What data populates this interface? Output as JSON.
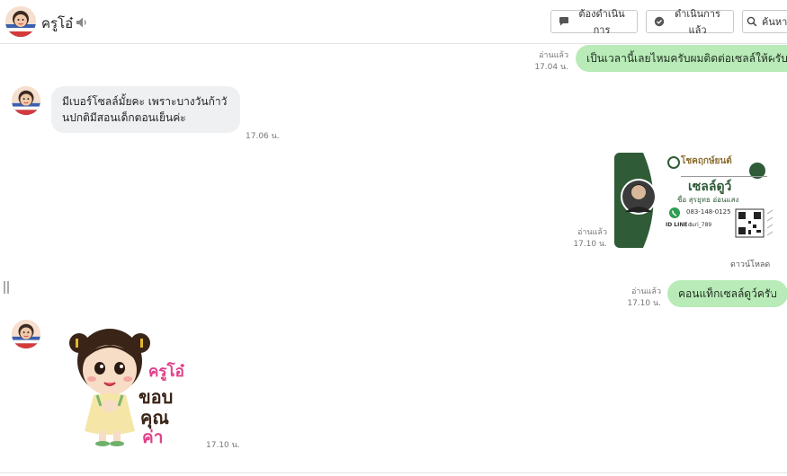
{
  "header": {
    "contact_name": "ครูโอ๋",
    "buttons": {
      "todo": "ต้องดำเนินการ",
      "done": "ดำเนินการแล้ว",
      "search": "ค้นหา"
    }
  },
  "messages": [
    {
      "id": "m1",
      "from": "me",
      "text": "เป็นเวลานี้เลยไหมครับผมติดต่อเซลล์ให้ครับ",
      "read": "อ่านแล้ว",
      "time": "17.04 น."
    },
    {
      "id": "m2",
      "from": "them",
      "text": "มีเบอร์โซลล์มั้ยคะ เพราะบางวันก้าวันปกติมีสอนเด็กตอนเย็นค่ะ",
      "time": "17.06 น."
    },
    {
      "id": "m3",
      "from": "me",
      "type": "image",
      "read": "อ่านแล้ว",
      "time": "17.10 น.",
      "download": "ดาวน์โหลด",
      "card": {
        "brand": "โชคฤกษ์ยนต์",
        "title": "เซลล์ดูว์",
        "name": "ชื่อ สุรยุทธ อ่อนแสง",
        "phone": "083-148-0125",
        "line_label": "ID LINE :",
        "line_id": "duri_789"
      }
    },
    {
      "id": "m4",
      "from": "me",
      "text": "คอนแท็กเซลล์ดูว์ครับ",
      "read": "อ่านแล้ว",
      "time": "17.10 น."
    },
    {
      "id": "m5",
      "from": "them",
      "type": "sticker",
      "time": "17.10 น.",
      "sticker_text": [
        "ครูโอ๋",
        "ขอบ",
        "คุณ",
        "ค่า"
      ]
    }
  ],
  "colors": {
    "my_bubble": "#b8ebb7",
    "their_bubble": "#eef0f2",
    "card_green": "#2f5b37"
  }
}
